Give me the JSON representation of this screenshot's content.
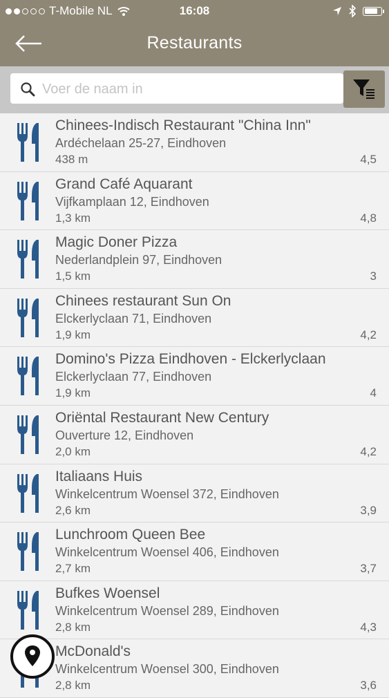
{
  "status_bar": {
    "carrier": "T-Mobile NL",
    "time": "16:08",
    "signal_bars": 2
  },
  "nav": {
    "title": "Restaurants"
  },
  "search": {
    "placeholder": "Voer de naam in",
    "value": ""
  },
  "restaurants": [
    {
      "name": "Chinees-Indisch Restaurant \"China Inn\"",
      "address": "Ardéchelaan 25-27, Eindhoven",
      "distance": "438 m",
      "rating": "4,5"
    },
    {
      "name": "Grand Café Aquarant",
      "address": "Vijfkamplaan 12, Eindhoven",
      "distance": "1,3 km",
      "rating": "4,8"
    },
    {
      "name": "Magic Doner Pizza",
      "address": "Nederlandplein 97, Eindhoven",
      "distance": "1,5 km",
      "rating": "3"
    },
    {
      "name": "Chinees restaurant Sun On",
      "address": "Elckerlyclaan 71, Eindhoven",
      "distance": "1,9 km",
      "rating": "4,2"
    },
    {
      "name": "Domino's Pizza Eindhoven - Elckerlyclaan",
      "address": "Elckerlyclaan 77, Eindhoven",
      "distance": "1,9 km",
      "rating": "4"
    },
    {
      "name": "Oriëntal Restaurant New Century",
      "address": "Ouverture 12, Eindhoven",
      "distance": "2,0 km",
      "rating": "4,2"
    },
    {
      "name": "Italiaans Huis",
      "address": "Winkelcentrum Woensel 372, Eindhoven",
      "distance": "2,6 km",
      "rating": "3,9"
    },
    {
      "name": "Lunchroom Queen Bee",
      "address": "Winkelcentrum Woensel 406, Eindhoven",
      "distance": "2,7 km",
      "rating": "3,7"
    },
    {
      "name": "Bufkes Woensel",
      "address": "Winkelcentrum Woensel 289, Eindhoven",
      "distance": "2,8 km",
      "rating": "4,3"
    },
    {
      "name": "McDonald's",
      "address": "Winkelcentrum Woensel 300, Eindhoven",
      "distance": "2,8 km",
      "rating": "3,6"
    }
  ],
  "colors": {
    "header": "#8e8775",
    "icon_blue": "#2a5a8c",
    "search_bg": "#c7c7c7",
    "list_bg": "#f2f2f2"
  },
  "icons": {
    "back": "arrow-left-icon",
    "search": "magnifier-icon",
    "filter": "funnel-filter-icon",
    "item": "cutlery-icon",
    "map": "location-pin-icon"
  }
}
